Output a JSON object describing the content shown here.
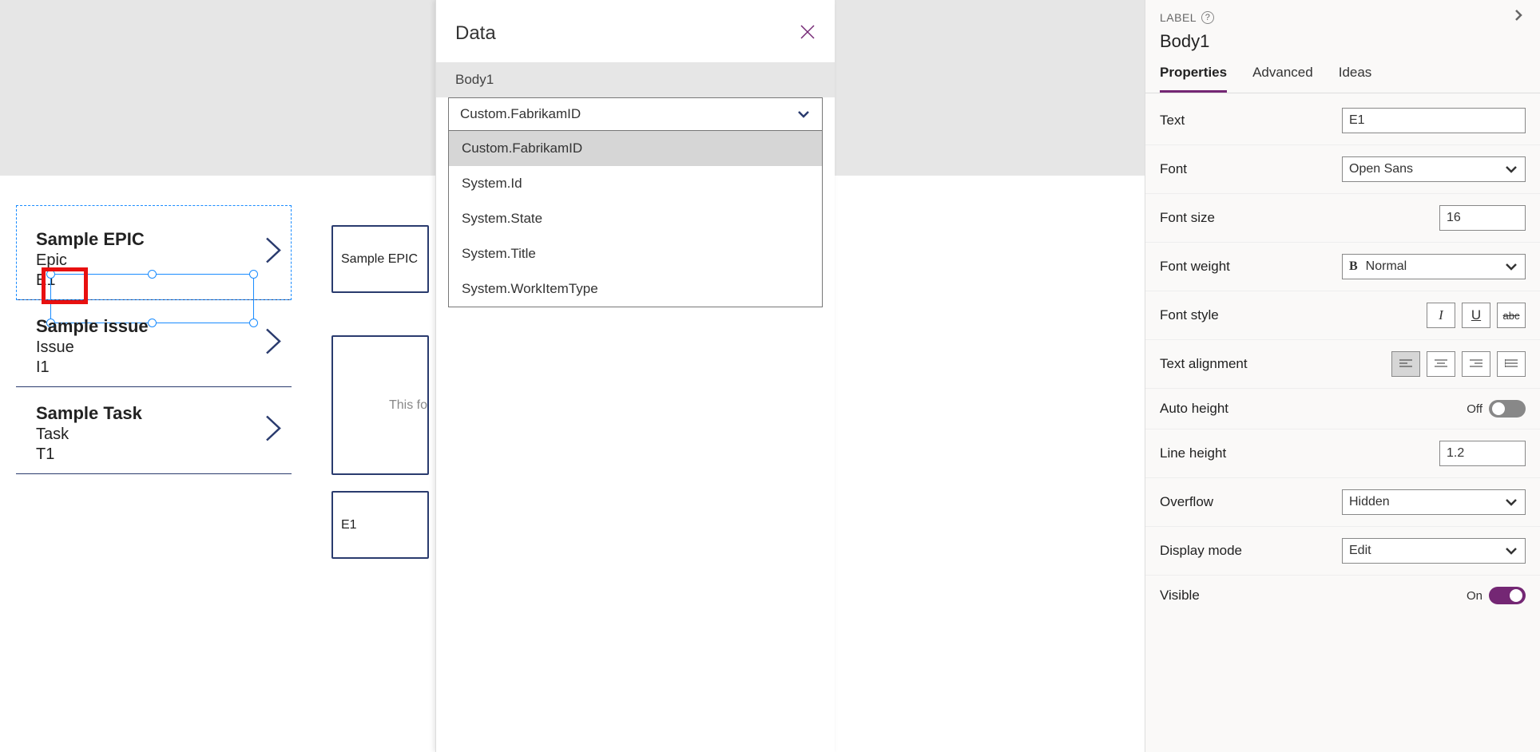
{
  "items": [
    {
      "title": "Sample EPIC",
      "type": "Epic",
      "code": "E1"
    },
    {
      "title": "Sample issue",
      "type": "Issue",
      "code": "I1"
    },
    {
      "title": "Sample Task",
      "type": "Task",
      "code": "T1"
    }
  ],
  "preview": {
    "card1": "Sample EPIC",
    "placeholder": "This fo",
    "card2": "E1"
  },
  "dataPanel": {
    "title": "Data",
    "section": "Body1",
    "selected": "Custom.FabrikamID",
    "options": [
      "Custom.FabrikamID",
      "System.Id",
      "System.State",
      "System.Title",
      "System.WorkItemType"
    ]
  },
  "props": {
    "typeLabel": "LABEL",
    "elementName": "Body1",
    "tabs": [
      "Properties",
      "Advanced",
      "Ideas"
    ],
    "text": {
      "label": "Text",
      "value": "E1"
    },
    "font": {
      "label": "Font",
      "value": "Open Sans"
    },
    "fontSize": {
      "label": "Font size",
      "value": "16"
    },
    "fontWeight": {
      "label": "Font weight",
      "value": "Normal"
    },
    "fontStyle": {
      "label": "Font style"
    },
    "textAlign": {
      "label": "Text alignment"
    },
    "autoHeight": {
      "label": "Auto height",
      "value": "Off"
    },
    "lineHeight": {
      "label": "Line height",
      "value": "1.2"
    },
    "overflow": {
      "label": "Overflow",
      "value": "Hidden"
    },
    "displayMode": {
      "label": "Display mode",
      "value": "Edit"
    },
    "visible": {
      "label": "Visible",
      "value": "On"
    }
  }
}
